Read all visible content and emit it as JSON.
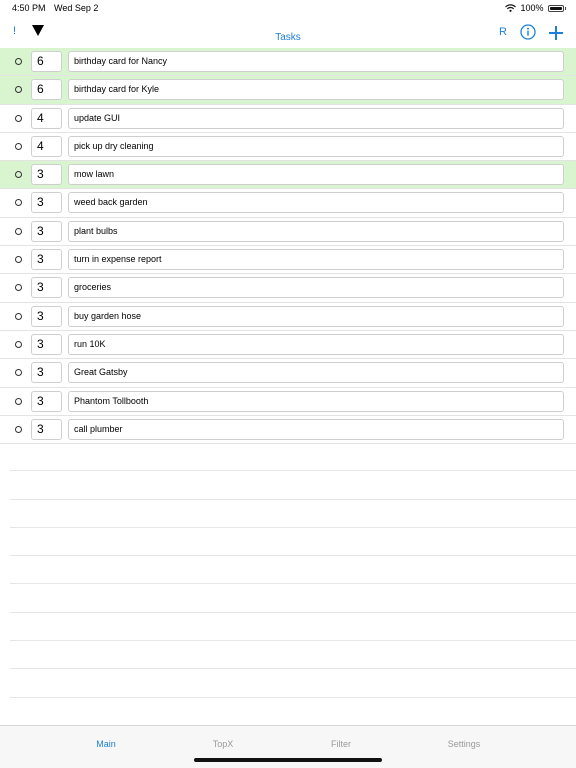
{
  "status": {
    "time": "4:50 PM",
    "date": "Wed Sep 2",
    "battery": "100%"
  },
  "nav": {
    "bang": "!",
    "title": "Tasks",
    "r_label": "R",
    "icons": [
      "sort-down-icon",
      "info-icon",
      "plus-icon"
    ]
  },
  "tasks": [
    {
      "priority": "6",
      "title": "birthday card for Nancy",
      "highlighted": true
    },
    {
      "priority": "6",
      "title": "birthday card for Kyle",
      "highlighted": true
    },
    {
      "priority": "4",
      "title": "update GUI",
      "highlighted": false
    },
    {
      "priority": "4",
      "title": "pick up dry cleaning",
      "highlighted": false
    },
    {
      "priority": "3",
      "title": "mow lawn",
      "highlighted": true
    },
    {
      "priority": "3",
      "title": "weed back garden",
      "highlighted": false
    },
    {
      "priority": "3",
      "title": "plant bulbs",
      "highlighted": false
    },
    {
      "priority": "3",
      "title": "turn in expense report",
      "highlighted": false
    },
    {
      "priority": "3",
      "title": "groceries",
      "highlighted": false
    },
    {
      "priority": "3",
      "title": "buy garden hose",
      "highlighted": false
    },
    {
      "priority": "3",
      "title": "run 10K",
      "highlighted": false
    },
    {
      "priority": "3",
      "title": "Great Gatsby",
      "highlighted": false
    },
    {
      "priority": "3",
      "title": "Phantom Tollbooth",
      "highlighted": false
    },
    {
      "priority": "3",
      "title": "call plumber",
      "highlighted": false
    }
  ],
  "tabs": [
    {
      "label": "Main",
      "active": true
    },
    {
      "label": "TopX",
      "active": false
    },
    {
      "label": "Filter",
      "active": false
    },
    {
      "label": "Settings",
      "active": false
    }
  ],
  "colors": {
    "accent": "#1e7fd8",
    "highlight": "#d9f5cf"
  }
}
